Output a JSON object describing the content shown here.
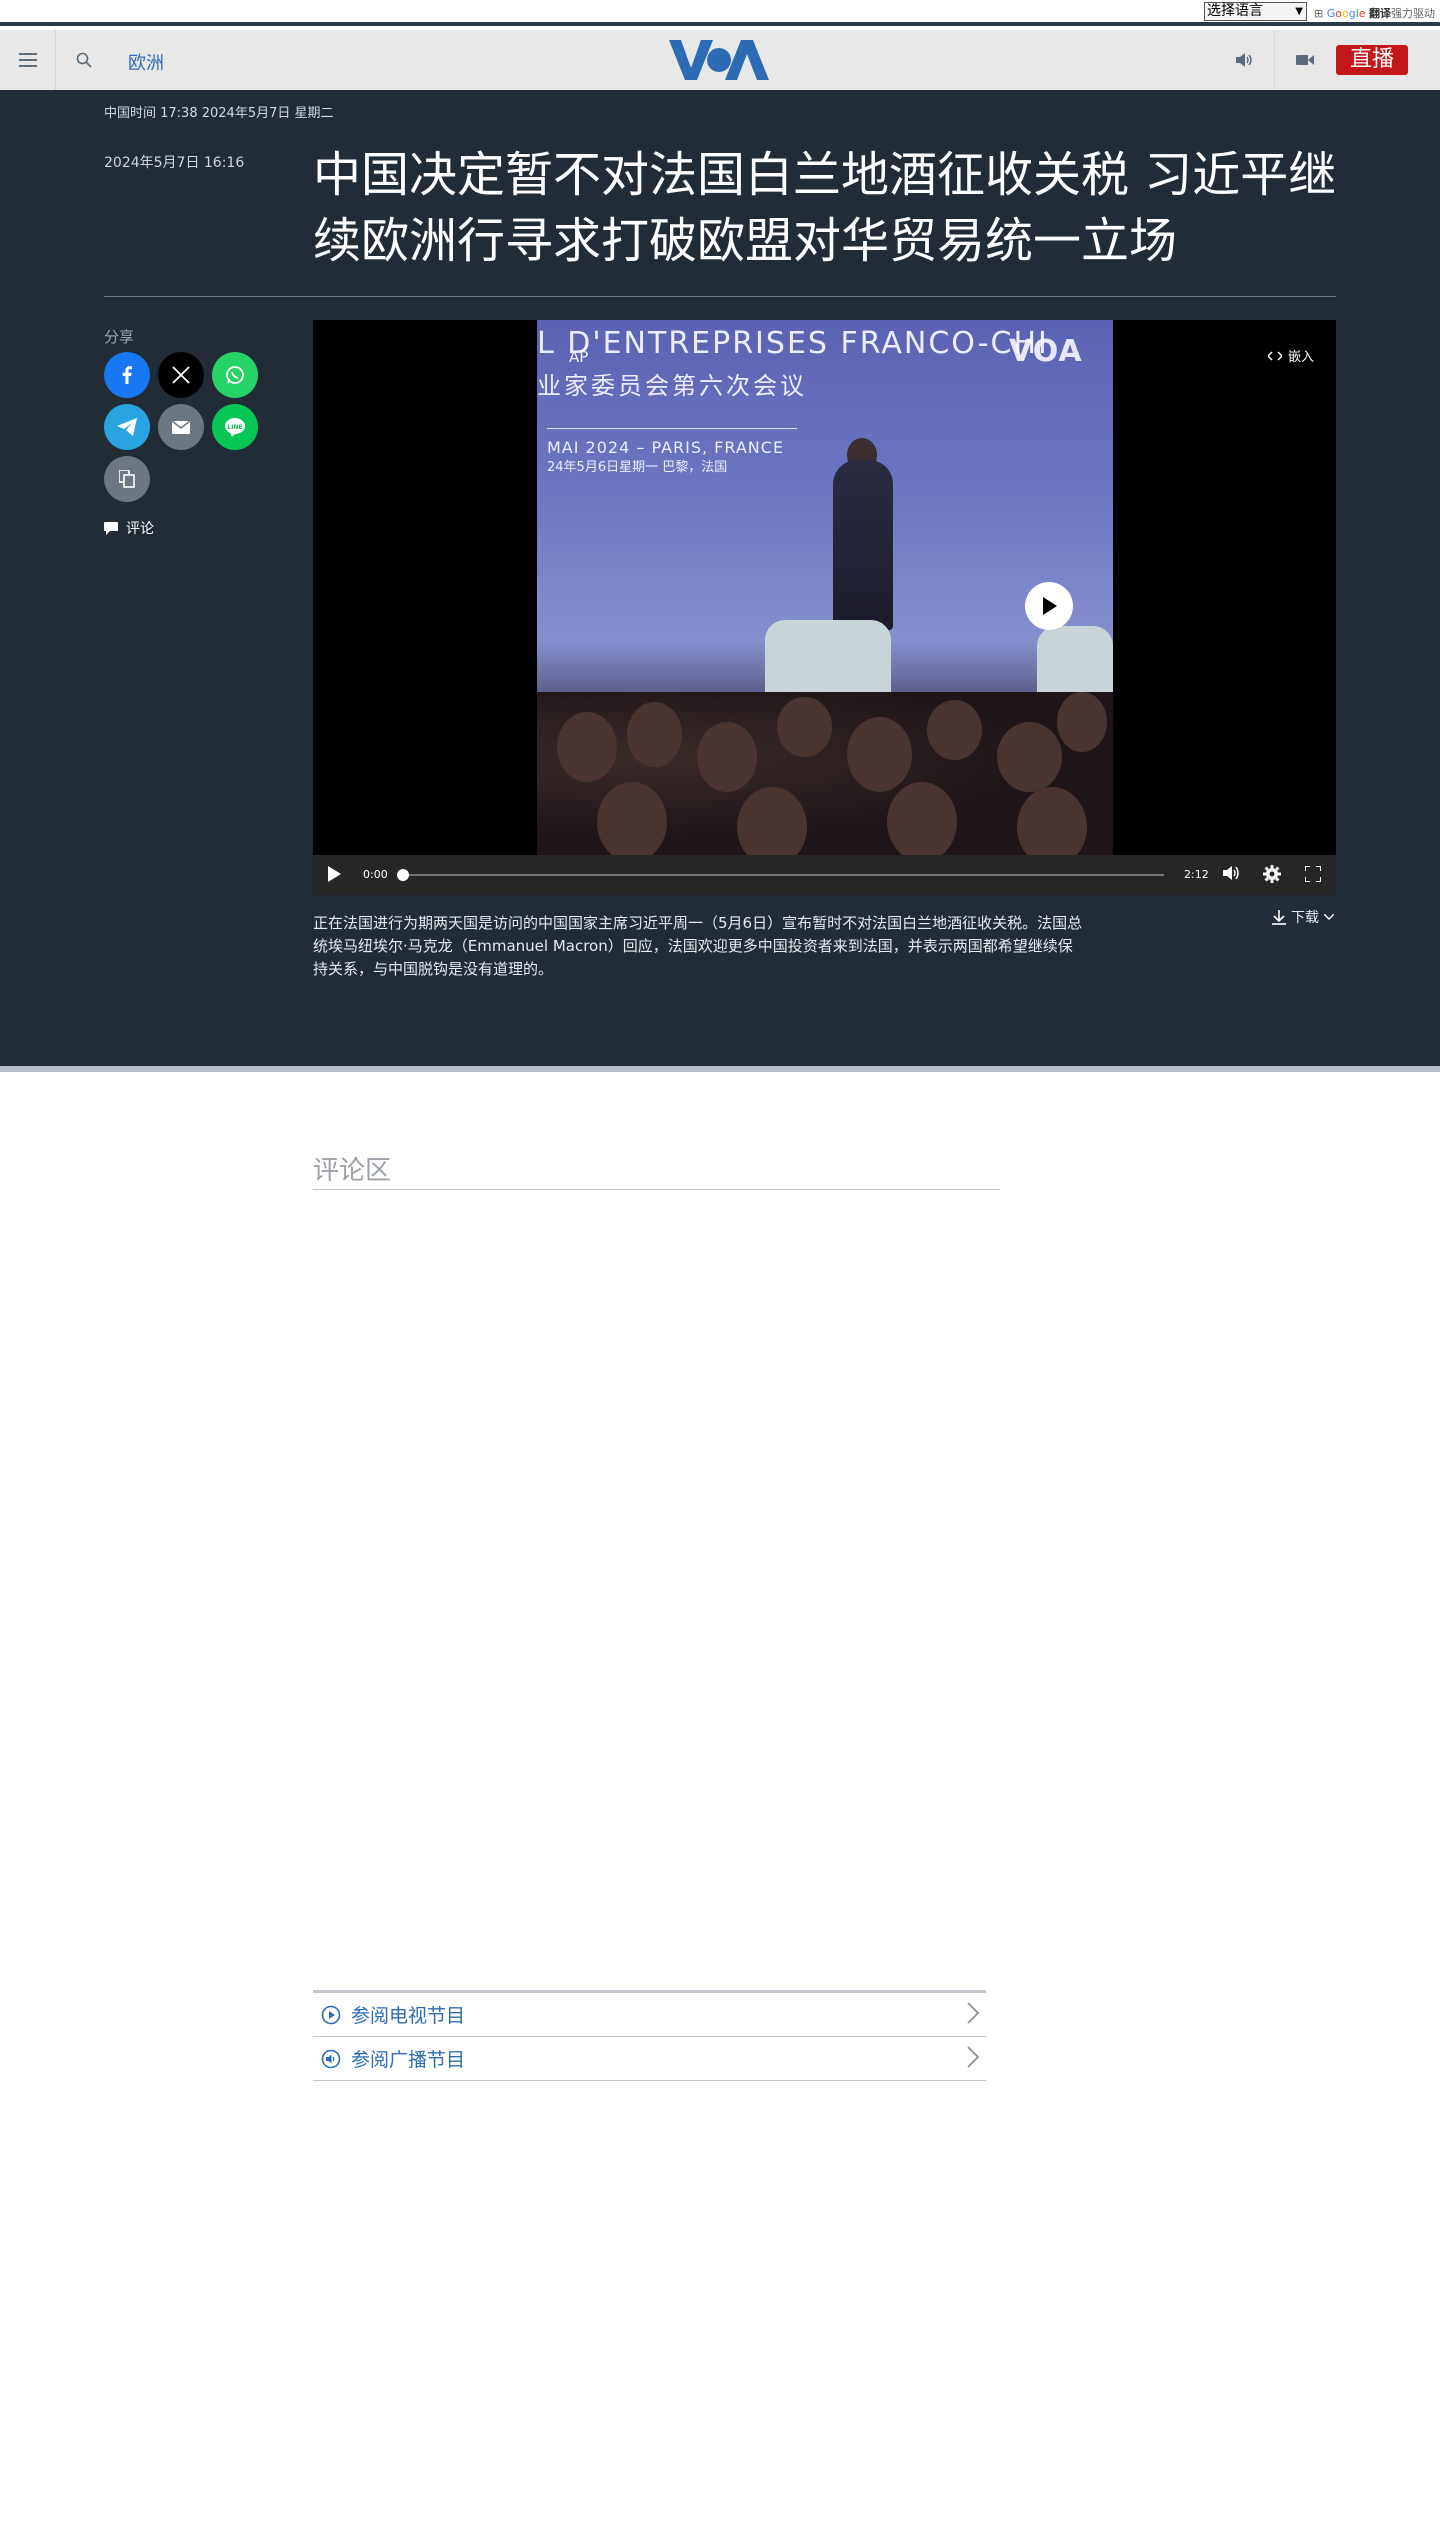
{
  "translate_bar": {
    "select_value": "选择语言",
    "powered_by": "Google",
    "translate_word": "翻译",
    "powered_suffix": "强力驱动"
  },
  "nav": {
    "section": "欧洲",
    "logo_text": "VOA",
    "live_label": "直播"
  },
  "article": {
    "timestamp_bar": "中国时间 17:38 2024年5月7日 星期二",
    "pub_date": "2024年5月7日 16:16",
    "headline": "中国决定暂不对法国白兰地酒征收关税 习近平继续欧洲行寻求打破欧盟对华贸易统一立场",
    "share_label": "分享",
    "comment_link": "评论",
    "caption": "正在法国进行为期两天国是访问的中国国家主席习近平周一（5月6日）宣布暂时不对法国白兰地酒征收关税。法国总统埃马纽埃尔·马克龙（Emmanuel Macron）回应，法国欢迎更多中国投资者来到法国，并表示两国都希望继续保持关系，与中国脱钩是没有道理的。",
    "download_label": "下载"
  },
  "video": {
    "banner_line1": "L D'ENTREPRISES FRANCO-CHI",
    "banner_line2": "业家委员会第六次会议",
    "date_line1": "MAI 2024 – PARIS, FRANCE",
    "date_line2": "24年5月6日星期一  巴黎，法国",
    "ap_label": "AP",
    "watermark": "VOA",
    "embed_label": "嵌入",
    "current_time": "0:00",
    "duration": "2:12",
    "progress": 0
  },
  "comments": {
    "title": "评论区"
  },
  "bottom_links": [
    {
      "label": "参阅电视节目",
      "icon": "play-circle-icon"
    },
    {
      "label": "参阅广播节目",
      "icon": "audio-circle-icon"
    }
  ],
  "colors": {
    "hero_bg": "#212c37",
    "brand_blue": "#2d6cb5",
    "live_red": "#c4171c"
  }
}
